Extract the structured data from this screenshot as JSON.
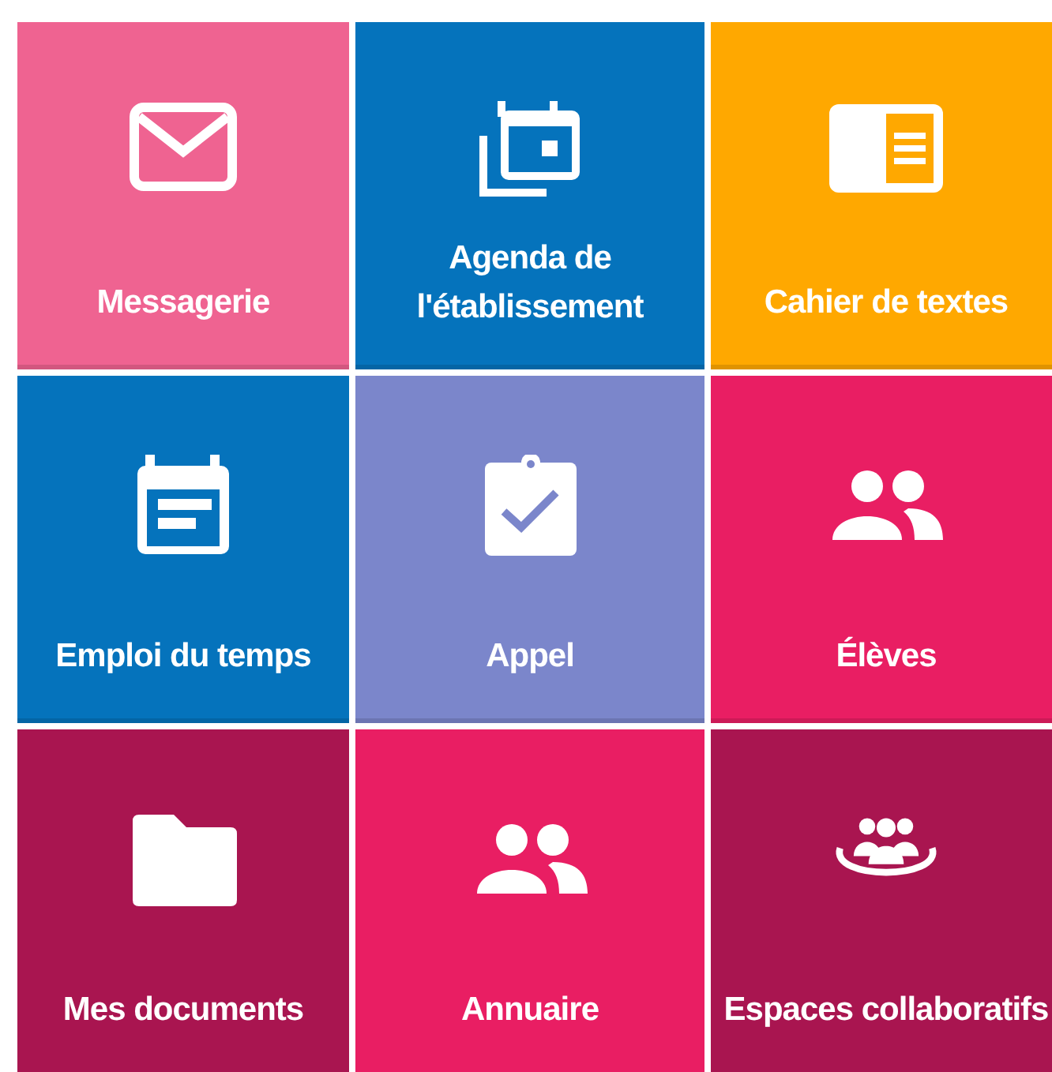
{
  "rows": [
    {
      "tiles": [
        {
          "label": "Messagerie",
          "kind": "mail",
          "color": "#ef6391"
        },
        {
          "label": "Agenda de l'établissement",
          "kind": "agenda",
          "color": "#0573bc"
        },
        {
          "label": "Cahier de textes",
          "kind": "notebook",
          "color": "#ffa800"
        }
      ]
    },
    {
      "tiles": [
        {
          "label": "Emploi du temps",
          "kind": "timetable",
          "color": "#0573bc"
        },
        {
          "label": "Appel",
          "kind": "rollcall",
          "color": "#7b86cb"
        },
        {
          "label": "Élèves",
          "kind": "people",
          "color": "#e91e63"
        }
      ]
    },
    {
      "tiles": [
        {
          "label": "Mes documents",
          "kind": "folder",
          "color": "#a91550"
        },
        {
          "label": "Annuaire",
          "kind": "people",
          "color": "#e91e63"
        },
        {
          "label": "Espaces collaboratifs",
          "kind": "group",
          "color": "#a91550"
        }
      ]
    }
  ]
}
